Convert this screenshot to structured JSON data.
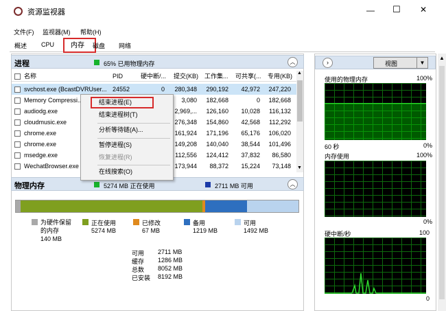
{
  "window": {
    "title": "资源监视器",
    "min": "—",
    "max": "☐",
    "close": "✕"
  },
  "menubar": [
    "文件(F)",
    "监视器(M)",
    "帮助(H)"
  ],
  "tabs": [
    "概述",
    "CPU",
    "内存",
    "磁盘",
    "网络"
  ],
  "active_tab": "内存",
  "process": {
    "title": "进程",
    "mem_pct": "65% 已用物理内存",
    "columns": [
      "名称",
      "PID",
      "硬中断/...",
      "提交(KB)",
      "工作集...",
      "可共享(...",
      "专用(KB)"
    ],
    "rows": [
      [
        "svchost.exe (BcastDVRUser...",
        "24552",
        "0",
        "280,348",
        "290,192",
        "42,972",
        "247,220"
      ],
      [
        "Memory Compressi...",
        "",
        "",
        "3,080",
        "182,668",
        "0",
        "182,668"
      ],
      [
        "audiodg.exe",
        "",
        "",
        "2,969,...",
        "126,160",
        "10,028",
        "116,132"
      ],
      [
        "cloudmusic.exe",
        "",
        "",
        "276,348",
        "154,860",
        "42,568",
        "112,292"
      ],
      [
        "chrome.exe",
        "",
        "",
        "161,924",
        "171,196",
        "65,176",
        "106,020"
      ],
      [
        "chrome.exe",
        "",
        "",
        "149,208",
        "140,040",
        "38,544",
        "101,496"
      ],
      [
        "msedge.exe",
        "",
        "",
        "112,556",
        "124,412",
        "37,832",
        "86,580"
      ],
      [
        "WechatBrowser.exe",
        "",
        "",
        "173,944",
        "88,372",
        "15,224",
        "73,148"
      ]
    ]
  },
  "context_menu": [
    "结束进程(E)",
    "结束进程树(T)",
    "分析等待链(A)...",
    "暂停进程(S)",
    "恢复进程(R)",
    "在线搜索(O)"
  ],
  "physical": {
    "title": "物理内存",
    "in_use": "5274 MB 正在使用",
    "available": "2711 MB 可用",
    "bar_fractions": {
      "reserved": 0.0171,
      "in_use": 0.6438,
      "modified": 0.0082,
      "standby": 0.1488,
      "free": 0.1821
    },
    "legend": [
      {
        "label": "为硬件保留的内存",
        "value": "140 MB",
        "color": "#a9a9a9"
      },
      {
        "label": "正在使用",
        "value": "5274 MB",
        "color": "#7f9f1f"
      },
      {
        "label": "已修改",
        "value": "67 MB",
        "color": "#e08a1e"
      },
      {
        "label": "备用",
        "value": "1219 MB",
        "color": "#2e6fbf"
      },
      {
        "label": "可用",
        "value": "1492 MB",
        "color": "#b9d3ee"
      }
    ],
    "stats": [
      [
        "可用",
        "2711 MB"
      ],
      [
        "缓存",
        "1286 MB"
      ],
      [
        "总数",
        "8052 MB"
      ],
      [
        "已安装",
        "8192 MB"
      ]
    ]
  },
  "right": {
    "view": "视图",
    "graphs": [
      {
        "title": "使用的物理内存",
        "top": "100%",
        "bottom_left": "60 秒",
        "bottom_right": "0%"
      },
      {
        "title": "内存使用",
        "top": "100%",
        "bottom_left": "",
        "bottom_right": "0%"
      },
      {
        "title": "硬中断/秒",
        "top": "100",
        "bottom_left": "",
        "bottom_right": "0"
      }
    ]
  }
}
